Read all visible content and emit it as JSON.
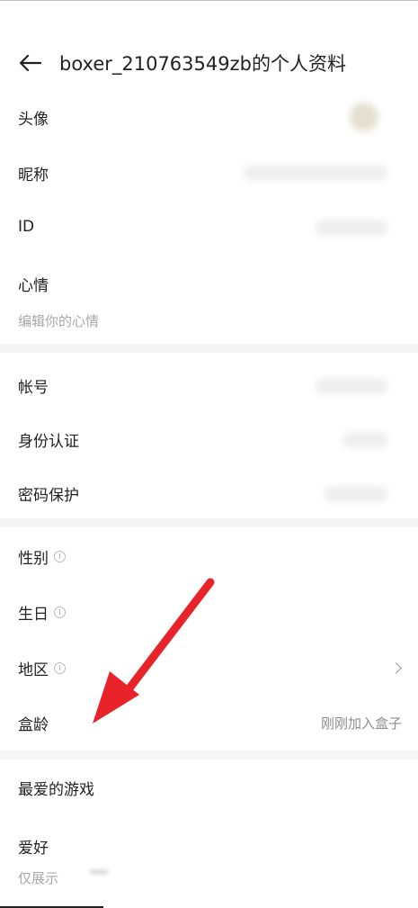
{
  "header": {
    "title": "boxer_210763549zb的个人资料"
  },
  "rows": {
    "avatar": "头像",
    "nickname": "昵称",
    "id": "ID",
    "mood": "心情",
    "mood_placeholder": "编辑你的心情",
    "account": "帐号",
    "identity": "身份认证",
    "password": "密码保护",
    "gender": "性别",
    "birthday": "生日",
    "region": "地区",
    "box_age": "盒龄",
    "box_age_value": "刚刚加入盒子",
    "fav_games": "最爱的游戏",
    "hobbies": "爱好",
    "hobbies_hint": "仅展示"
  },
  "colors": {
    "annotation_arrow": "#e8232a"
  }
}
